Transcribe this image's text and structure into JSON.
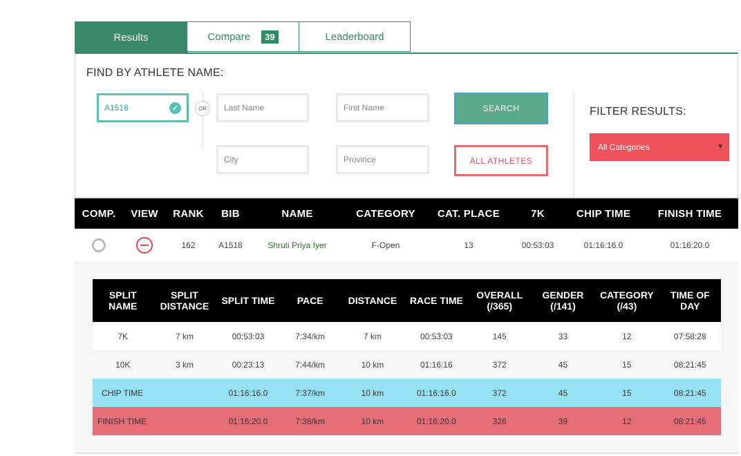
{
  "tabs": {
    "results": "Results",
    "compare": "Compare",
    "compare_count": "39",
    "leaderboard": "Leaderboard"
  },
  "search": {
    "title": "FIND BY ATHLETE NAME:",
    "bib_value": "A1518",
    "or_label": "OR",
    "last_name_placeholder": "Last Name",
    "first_name_placeholder": "First Name",
    "city_placeholder": "City",
    "province_placeholder": "Province",
    "search_button": "SEARCH",
    "all_athletes_button": "ALL ATHLETES"
  },
  "filter": {
    "title": "FILTER RESULTS:",
    "selected": "All Categories"
  },
  "results": {
    "headers": [
      "COMP.",
      "VIEW",
      "RANK",
      "BIB",
      "NAME",
      "CATEGORY",
      "CAT. PLACE",
      "7K",
      "CHIP TIME",
      "FINISH TIME"
    ],
    "row": {
      "rank": "162",
      "bib": "A1518",
      "name": "Shruti Priya Iyer",
      "category": "F-Open",
      "cat_place": "13",
      "split_7k": "00:53:03",
      "chip_time": "01:16:16.0",
      "finish_time": "01:16:20.0"
    }
  },
  "splits": {
    "headers": {
      "split_name_1": "SPLIT",
      "split_name_2": "NAME",
      "split_distance_1": "SPLIT",
      "split_distance_2": "DISTANCE",
      "split_time": "SPLIT TIME",
      "pace": "PACE",
      "distance": "DISTANCE",
      "race_time": "RACE TIME",
      "overall_1": "OVERALL",
      "overall_2": "(/365)",
      "gender_1": "GENDER",
      "gender_2": "(/141)",
      "category_1": "CATEGORY",
      "category_2": "(/43)",
      "tod_1": "TIME OF",
      "tod_2": "DAY"
    },
    "rows": [
      {
        "name": "7K",
        "split_distance": "7 km",
        "split_time": "00:53:03",
        "pace": "7:34/km",
        "distance": "7 km",
        "race_time": "00:53:03",
        "overall": "145",
        "gender": "33",
        "category": "12",
        "time_of_day": "07:58:28"
      },
      {
        "name": "10K",
        "split_distance": "3 km",
        "split_time": "00:23:13",
        "pace": "7:44/km",
        "distance": "10 km",
        "race_time": "01:16:16",
        "overall": "372",
        "gender": "45",
        "category": "15",
        "time_of_day": "08:21:45"
      },
      {
        "name": "CHIP TIME",
        "split_distance": "",
        "split_time": "01:16:16.0",
        "pace": "7:37/km",
        "distance": "10 km",
        "race_time": "01:16:16.0",
        "overall": "372",
        "gender": "45",
        "category": "15",
        "time_of_day": "08:21:45"
      },
      {
        "name": "FINISH TIME",
        "split_distance": "",
        "split_time": "01:16:20.0",
        "pace": "7:38/km",
        "distance": "10 km",
        "race_time": "01:16:20.0",
        "overall": "326",
        "gender": "39",
        "category": "12",
        "time_of_day": "08:21:45"
      }
    ]
  },
  "colors": {
    "brand_green": "#3a8a6a",
    "alert_red": "#f0525c",
    "chip_row": "#96e2f5",
    "finish_row": "#e56e78"
  }
}
